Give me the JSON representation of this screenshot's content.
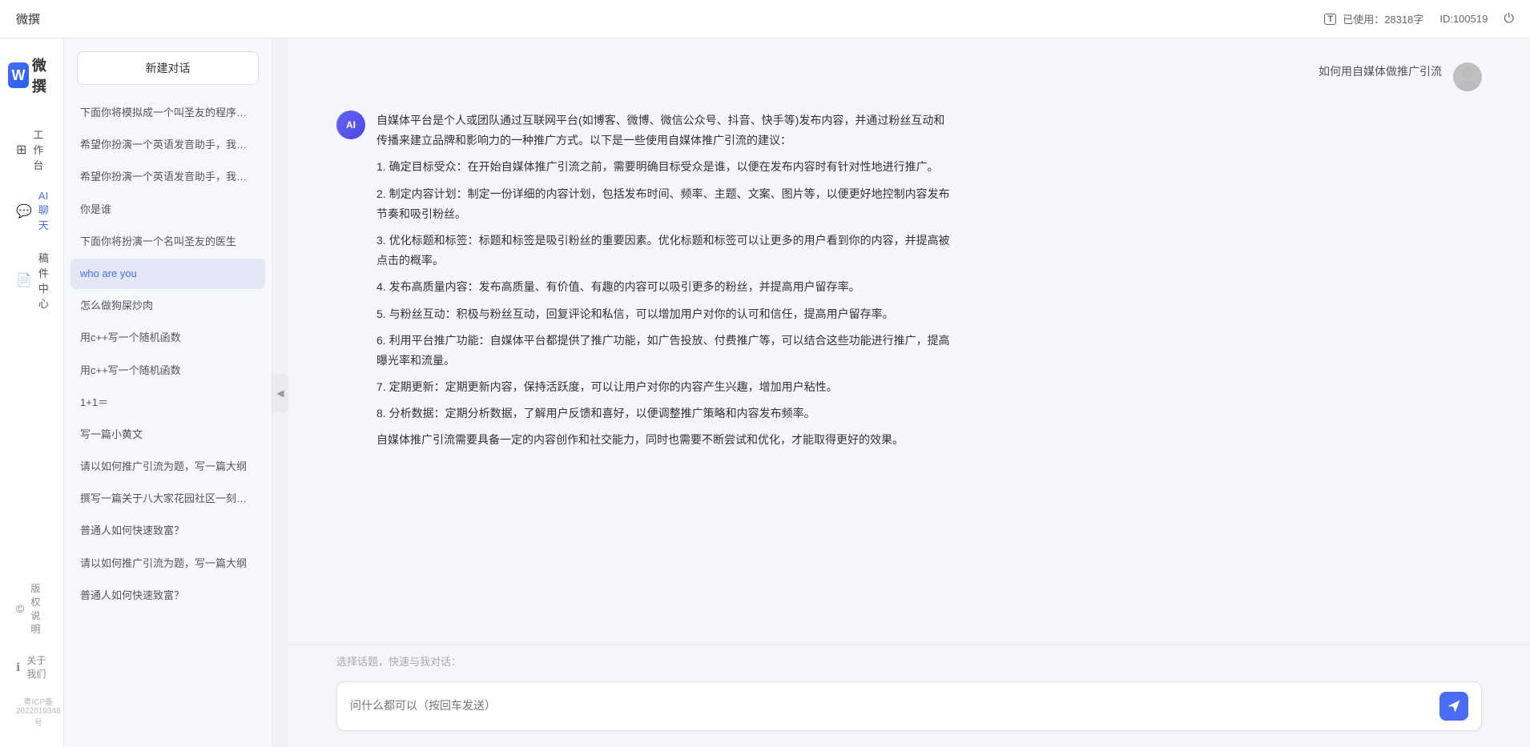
{
  "topbar": {
    "title": "微撰",
    "usage_label": "已使用：28318字",
    "id_label": "ID:100519",
    "usage_icon": "T"
  },
  "left_nav": {
    "logo_letter": "W",
    "logo_text": "微撰",
    "items": [
      {
        "id": "workbench",
        "label": "工作台",
        "icon": "⊞"
      },
      {
        "id": "ai-chat",
        "label": "AI聊天",
        "icon": "💬",
        "active": true
      },
      {
        "id": "mail-center",
        "label": "稿件中心",
        "icon": "📄"
      }
    ],
    "bottom_items": [
      {
        "id": "copyright",
        "label": "版权说明",
        "icon": "©"
      },
      {
        "id": "about",
        "label": "关于我们",
        "icon": "ℹ"
      }
    ],
    "icp": "粤ICP备2022019348号"
  },
  "chat_sidebar": {
    "new_chat_label": "新建对话",
    "history": [
      {
        "id": 1,
        "text": "下面你将模拟成一个叫圣友的程序员，我说...",
        "active": false
      },
      {
        "id": 2,
        "text": "希望你扮演一个英语发音助手，我提供给你...",
        "active": false
      },
      {
        "id": 3,
        "text": "希望你扮演一个英语发音助手，我提供给你...",
        "active": false
      },
      {
        "id": 4,
        "text": "你是谁",
        "active": false
      },
      {
        "id": 5,
        "text": "下面你将扮演一个名叫圣友的医生",
        "active": false
      },
      {
        "id": 6,
        "text": "who are you",
        "active": true
      },
      {
        "id": 7,
        "text": "怎么做狗屎炒肉",
        "active": false
      },
      {
        "id": 8,
        "text": "用c++写一个随机函数",
        "active": false
      },
      {
        "id": 9,
        "text": "用c++写一个随机函数",
        "active": false
      },
      {
        "id": 10,
        "text": "1+1＝",
        "active": false
      },
      {
        "id": 11,
        "text": "写一篇小黄文",
        "active": false
      },
      {
        "id": 12,
        "text": "请以如何推广引流为题，写一篇大纲",
        "active": false
      },
      {
        "id": 13,
        "text": "撰写一篇关于八大家花园社区一刻钟便民生...",
        "active": false
      },
      {
        "id": 14,
        "text": "普通人如何快速致富？",
        "active": false
      },
      {
        "id": 15,
        "text": "请以如何推广引流为题，写一篇大纲",
        "active": false
      },
      {
        "id": 16,
        "text": "普通人如何快速致富？",
        "active": false
      }
    ]
  },
  "chat": {
    "messages": [
      {
        "id": 1,
        "role": "user",
        "avatar_type": "user",
        "text": "如何用自媒体做推广引流"
      },
      {
        "id": 2,
        "role": "ai",
        "avatar_label": "AI",
        "text": "自媒体平台是个人或团队通过互联网平台(如博客、微博、微信公众号、抖音、快手等)发布内容，并通过粉丝互动和传播来建立品牌和影响力的一种推广方式。以下是一些使用自媒体推广引流的建议：\n\n1. 确定目标受众：在开始自媒体推广引流之前，需要明确目标受众是谁，以便在发布内容时有针对性地进行推广。\n\n2. 制定内容计划：制定一份详细的内容计划，包括发布时间、频率、主题、文案、图片等，以便更好地控制内容发布节奏和吸引粉丝。\n\n3. 优化标题和标签：标题和标签是吸引粉丝的重要因素。优化标题和标签可以让更多的用户看到你的内容，并提高被点击的概率。\n\n4. 发布高质量内容：发布高质量、有价值、有趣的内容可以吸引更多的粉丝，并提高用户留存率。\n\n5. 与粉丝互动：积极与粉丝互动，回复评论和私信，可以增加用户对你的认可和信任，提高用户留存率。\n\n6. 利用平台推广功能：自媒体平台都提供了推广功能，如广告投放、付费推广等，可以结合这些功能进行推广，提高曝光率和流量。\n\n7. 定期更新：定期更新内容，保持活跃度，可以让用户对你的内容产生兴趣，增加用户粘性。\n\n8. 分析数据：定期分析数据，了解用户反馈和喜好，以便调整推广策略和内容发布频率。\n\n自媒体推广引流需要具备一定的内容创作和社交能力，同时也需要不断尝试和优化，才能取得更好的效果。"
      }
    ],
    "quick_topics_label": "选择话题，快速与我对话：",
    "input_placeholder": "问什么都可以（按回车发送）"
  }
}
